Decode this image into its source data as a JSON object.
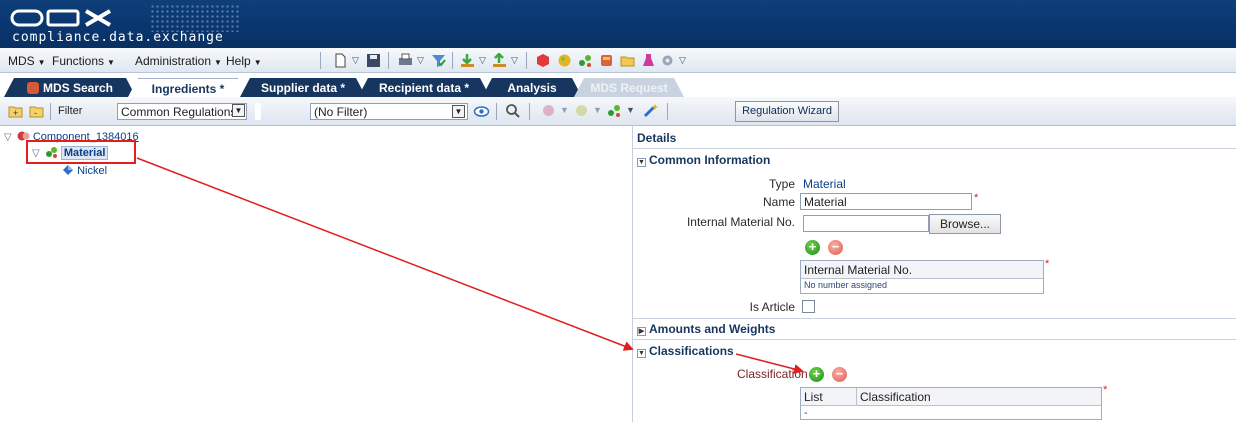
{
  "banner": {
    "logo_text": "CDX",
    "tagline": "compliance.data.exchange"
  },
  "menubar": {
    "items": [
      {
        "label": "MDS"
      },
      {
        "label": "Functions"
      },
      {
        "label": "Administration"
      },
      {
        "label": "Help"
      }
    ]
  },
  "tabs": [
    {
      "label": "MDS Search",
      "state": "inactive"
    },
    {
      "label": "Ingredients *",
      "state": "active"
    },
    {
      "label": "Supplier data *",
      "state": "inactive"
    },
    {
      "label": "Recipient data *",
      "state": "inactive"
    },
    {
      "label": "Analysis",
      "state": "inactive"
    },
    {
      "label": "MDS Request",
      "state": "disabled"
    }
  ],
  "toolbar": {
    "filter_label": "Filter",
    "filter_select": "Common Regulations",
    "filter_value_select": "(No Filter)",
    "wizard_label": "Regulation Wizard"
  },
  "tree": {
    "root": "Component_1384016",
    "material": "Material",
    "nickel": "Nickel"
  },
  "details": {
    "title": "Details",
    "common_info": {
      "header": "Common Information",
      "type_label": "Type",
      "type_value": "Material",
      "name_label": "Name",
      "name_value": "Material",
      "internal_no_label": "Internal Material No.",
      "internal_no_value": "",
      "browse_label": "Browse...",
      "table_header": "Internal Material No.",
      "table_value": "No number assigned",
      "is_article_label": "Is Article"
    },
    "amounts_header": "Amounts and Weights",
    "classifications": {
      "header": "Classifications",
      "label": "Classification",
      "col_list": "List",
      "col_classification": "Classification",
      "empty_value": "-"
    },
    "required_mark": "*"
  },
  "colors": {
    "banner": "#0a3670",
    "tab_dark": "#16355f",
    "link_blue": "#0b3f86",
    "annotation_red": "#e02020"
  }
}
